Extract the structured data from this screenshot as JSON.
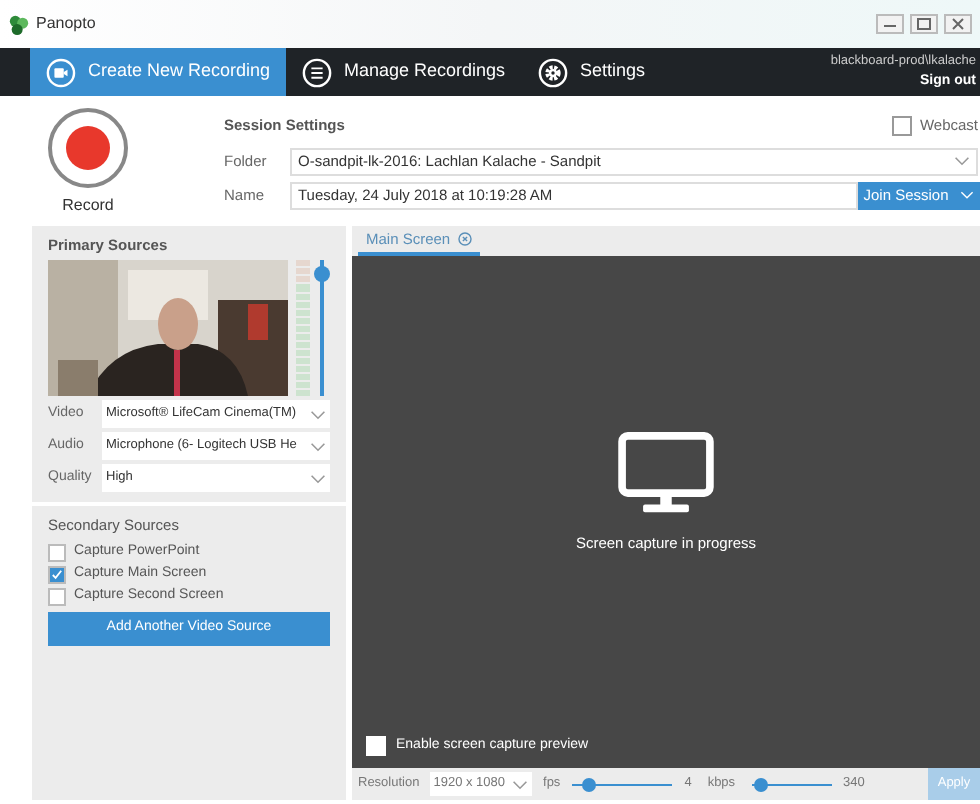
{
  "window": {
    "title": "Panopto"
  },
  "nav": {
    "tabs": [
      {
        "label": "Create New Recording",
        "kind": "camera",
        "selected": true
      },
      {
        "label": "Manage Recordings",
        "kind": "list",
        "selected": false
      },
      {
        "label": "Settings",
        "kind": "gear",
        "selected": false
      }
    ],
    "account": "blackboard-prod\\lkalache",
    "sign_out": "Sign out"
  },
  "record": {
    "label": "Record"
  },
  "session": {
    "title": "Session Settings",
    "webcast": {
      "label": "Webcast",
      "checked": false
    },
    "folder": {
      "label": "Folder",
      "value": "O-sandpit-lk-2016: Lachlan Kalache - Sandpit"
    },
    "name": {
      "label": "Name",
      "value": "Tuesday, 24 July 2018 at 10:19:28 AM"
    },
    "join_button": "Join Session"
  },
  "primary_sources": {
    "title": "Primary Sources",
    "volume": {
      "level": 0.95
    },
    "fields": [
      {
        "label": "Video",
        "value": "Microsoft® LifeCam Cinema(TM)"
      },
      {
        "label": "Audio",
        "value": "Microphone (6- Logitech USB He"
      },
      {
        "label": "Quality",
        "value": "High"
      }
    ]
  },
  "secondary_sources": {
    "title": "Secondary Sources",
    "options": [
      {
        "label": "Capture PowerPoint",
        "checked": false
      },
      {
        "label": "Capture Main Screen",
        "checked": true
      },
      {
        "label": "Capture Second Screen",
        "checked": false
      }
    ],
    "add_button": "Add Another Video Source"
  },
  "capture_tabs": [
    {
      "label": "Main Screen",
      "selected": true
    }
  ],
  "preview": {
    "message": "Screen capture in progress",
    "enable_preview": {
      "label": "Enable screen capture preview",
      "checked": false
    }
  },
  "bottom_bar": {
    "resolution": {
      "label": "Resolution",
      "value": "1920 x 1080"
    },
    "fps": {
      "label": "fps",
      "level": 0.15,
      "reading": "4"
    },
    "kbps": {
      "label": "kbps",
      "level": 0.1,
      "reading": "340"
    },
    "apply": {
      "label": "Apply",
      "disabled": true
    }
  }
}
